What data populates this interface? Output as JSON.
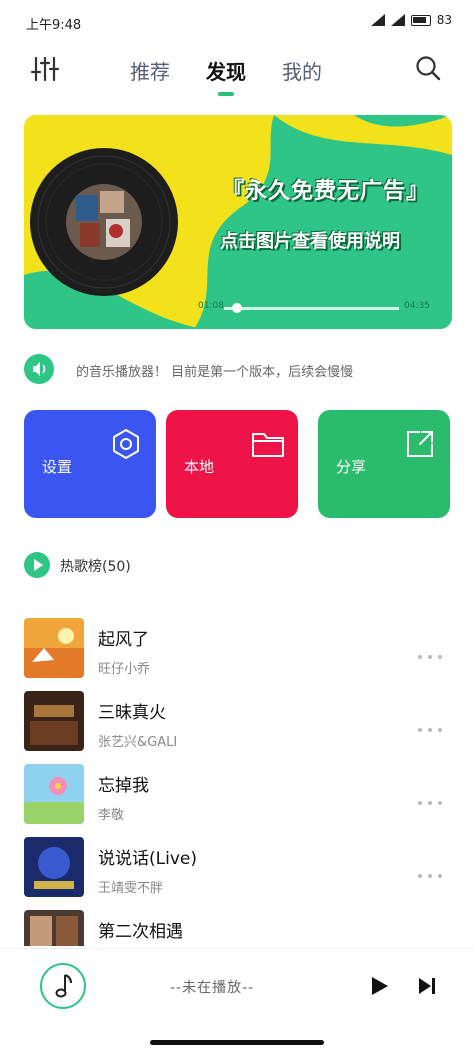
{
  "status_bar": {
    "time": "上午9:48",
    "battery": "83"
  },
  "header": {
    "tabs": [
      {
        "label": "推荐"
      },
      {
        "label": "发现"
      },
      {
        "label": "我的"
      }
    ],
    "active_tab": "发现",
    "left_icon": "equalizer-icon",
    "right_icon": "search-icon"
  },
  "banner": {
    "title": "『永久免费无广告』",
    "subtitle": "点击图片查看使用说明",
    "time_left": "01:08",
    "time_right": "04:35"
  },
  "notice": {
    "text": "的音乐播放器！ 目前是第一个版本，后续会慢慢",
    "icon": "speaker-icon"
  },
  "cards": [
    {
      "label": "设置",
      "icon": "gear-icon",
      "color": "#3b55f0"
    },
    {
      "label": "本地",
      "icon": "folder-icon",
      "color": "#ee1448"
    },
    {
      "label": "分享",
      "icon": "share-icon",
      "color": "#2bbb6c"
    }
  ],
  "hot_list": {
    "title": "热歌榜(50)"
  },
  "songs": [
    {
      "title": "起风了",
      "artist": "旺仔小乔"
    },
    {
      "title": "三昧真火",
      "artist": "张艺兴&GALI"
    },
    {
      "title": "忘掉我",
      "artist": "李敬"
    },
    {
      "title": "说说话(Live)",
      "artist": "王靖雯不胖"
    },
    {
      "title": "第二次相遇",
      "artist": ""
    }
  ],
  "player": {
    "status": "--未在播放--"
  },
  "colors": {
    "accent": "#2fc587",
    "banner_yellow": "#f3e21b",
    "banner_green": "#2fc587"
  }
}
